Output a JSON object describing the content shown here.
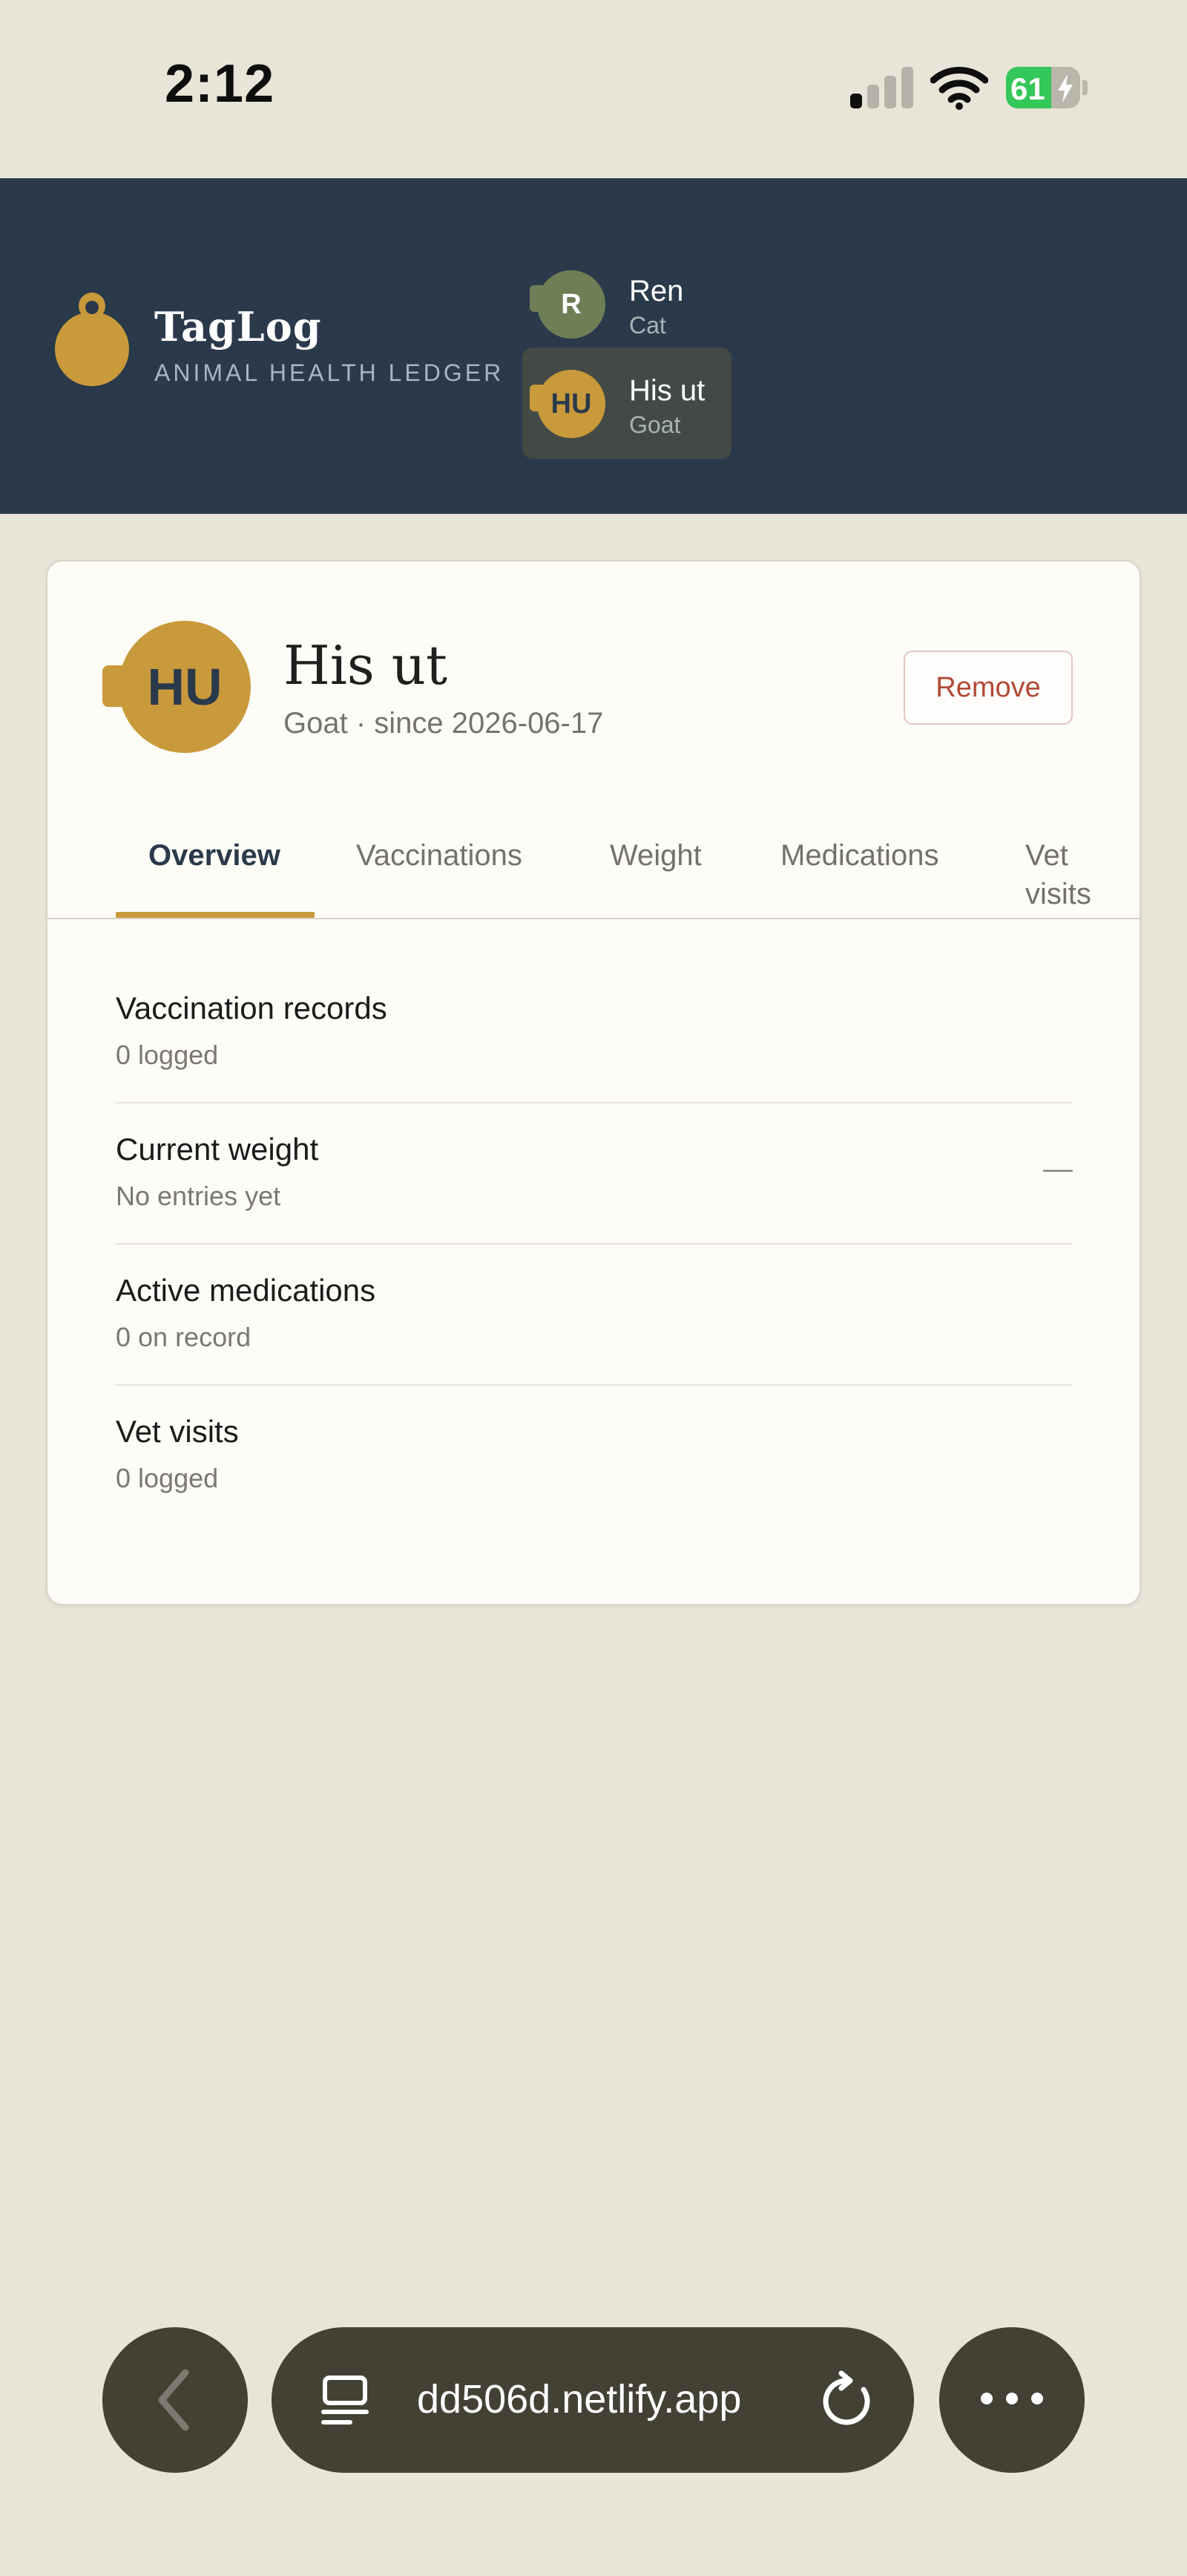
{
  "status_bar": {
    "time": "2:12",
    "battery_percent": "61",
    "battery_level": 0.61,
    "signal_bars_active": 1,
    "signal_bars_total": 4,
    "icons": [
      "signal-icon",
      "wifi-icon",
      "battery-charging-icon"
    ]
  },
  "header": {
    "brand_name": "TagLog",
    "brand_subtitle": "ANIMAL HEALTH LEDGER",
    "logo_icon": "tag-icon",
    "animals": [
      {
        "initials": "R",
        "name": "Ren",
        "type": "Cat",
        "color": "#6e7f55",
        "active": false
      },
      {
        "initials": "HU",
        "name": "His ut",
        "type": "Goat",
        "color": "#c99a3b",
        "active": true
      }
    ]
  },
  "profile": {
    "initials": "HU",
    "name": "His ut",
    "meta": "Goat · since 2026-06-17",
    "remove_label": "Remove",
    "avatar_color": "#c99a3b"
  },
  "tabs": [
    {
      "label": "Overview",
      "active": true
    },
    {
      "label": "Vaccinations",
      "active": false
    },
    {
      "label": "Weight",
      "active": false
    },
    {
      "label": "Medications",
      "active": false
    },
    {
      "label": "Vet visits",
      "active": false
    }
  ],
  "summary": [
    {
      "title": "Vaccination records",
      "sub": "0 logged",
      "value": ""
    },
    {
      "title": "Current weight",
      "sub": "No entries yet",
      "value": "—"
    },
    {
      "title": "Active medications",
      "sub": "0 on record",
      "value": ""
    },
    {
      "title": "Vet visits",
      "sub": "0 logged",
      "value": ""
    }
  ],
  "browser": {
    "url": "dd506d.netlify.app",
    "icons": [
      "back-icon",
      "tabs-icon",
      "reload-icon",
      "more-icon"
    ]
  },
  "colors": {
    "header_bg": "#2a3a4b",
    "page_bg": "#e8e5d8",
    "accent": "#c99a3b",
    "danger": "#b04a36",
    "browser_bar": "#434134"
  }
}
